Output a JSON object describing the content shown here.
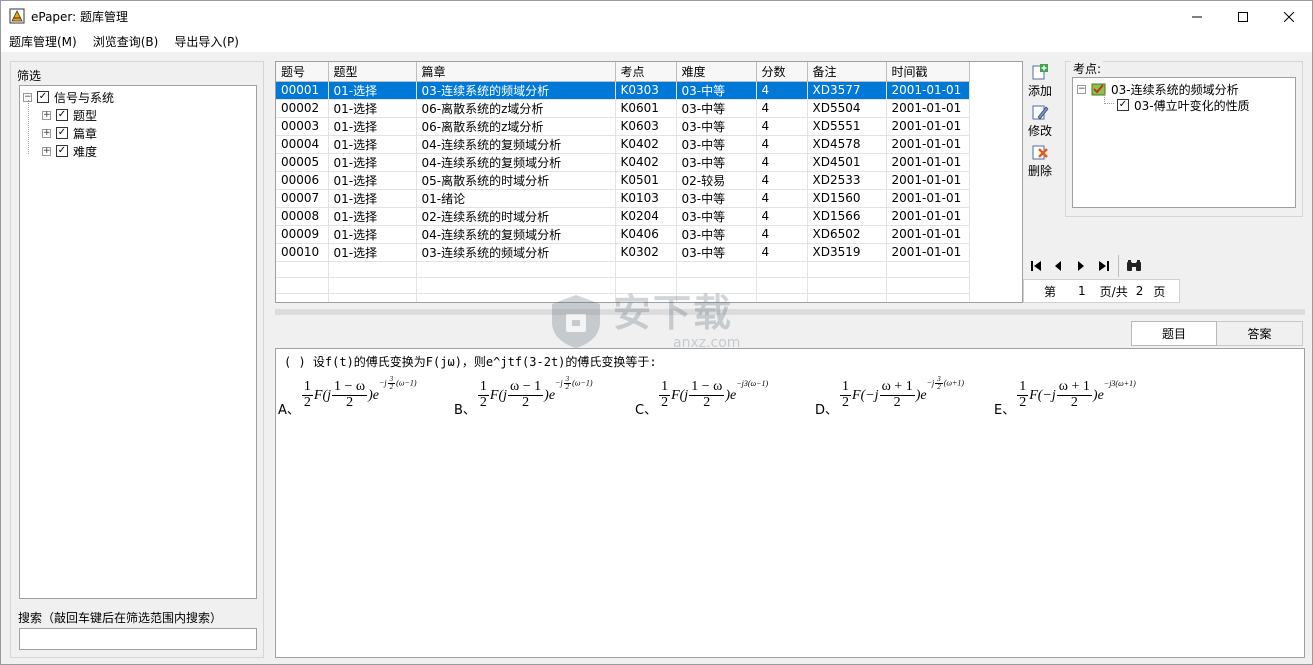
{
  "window": {
    "title": "ePaper: 题库管理",
    "controls": [
      "minimize",
      "maximize",
      "close"
    ]
  },
  "menu": [
    {
      "label": "题库管理(M)"
    },
    {
      "label": "浏览查询(B)"
    },
    {
      "label": "导出导入(P)"
    }
  ],
  "filter": {
    "label": "筛选",
    "tree": {
      "root": {
        "label": "信号与系统",
        "checked": true
      },
      "children": [
        {
          "label": "题型",
          "checked": true
        },
        {
          "label": "篇章",
          "checked": true
        },
        {
          "label": "难度",
          "checked": true
        }
      ]
    },
    "search_label": "搜索（敲回车键后在筛选范围内搜索）",
    "search_value": ""
  },
  "grid": {
    "columns": [
      "题号",
      "题型",
      "篇章",
      "考点",
      "难度",
      "分数",
      "备注",
      "时间戳"
    ],
    "rows": [
      [
        "00001",
        "01-选择",
        "03-连续系统的频域分析",
        "K0303",
        "03-中等",
        "4",
        "XD3577",
        "2001-01-01"
      ],
      [
        "00002",
        "01-选择",
        "06-离散系统的z域分析",
        "K0601",
        "03-中等",
        "4",
        "XD5504",
        "2001-01-01"
      ],
      [
        "00003",
        "01-选择",
        "06-离散系统的z域分析",
        "K0603",
        "03-中等",
        "4",
        "XD5551",
        "2001-01-01"
      ],
      [
        "00004",
        "01-选择",
        "04-连续系统的复频域分析",
        "K0402",
        "03-中等",
        "4",
        "XD4578",
        "2001-01-01"
      ],
      [
        "00005",
        "01-选择",
        "04-连续系统的复频域分析",
        "K0402",
        "03-中等",
        "4",
        "XD4501",
        "2001-01-01"
      ],
      [
        "00006",
        "01-选择",
        "05-离散系统的时域分析",
        "K0501",
        "02-较易",
        "4",
        "XD2533",
        "2001-01-01"
      ],
      [
        "00007",
        "01-选择",
        "01-绪论",
        "K0103",
        "03-中等",
        "4",
        "XD1560",
        "2001-01-01"
      ],
      [
        "00008",
        "01-选择",
        "02-连续系统的时域分析",
        "K0204",
        "03-中等",
        "4",
        "XD1566",
        "2001-01-01"
      ],
      [
        "00009",
        "01-选择",
        "04-连续系统的复频域分析",
        "K0406",
        "03-中等",
        "4",
        "XD6502",
        "2001-01-01"
      ],
      [
        "00010",
        "01-选择",
        "03-连续系统的频域分析",
        "K0302",
        "03-中等",
        "4",
        "XD3519",
        "2001-01-01"
      ]
    ],
    "selected_row": 0
  },
  "tools": {
    "add": "添加",
    "edit": "修改",
    "delete": "删除"
  },
  "kaodian": {
    "label": "考点:",
    "root": "03-连续系统的频域分析",
    "child": "03-傅立叶变化的性质"
  },
  "pager": {
    "prefix": "第",
    "current": "1",
    "middle": "页/共",
    "total": "2",
    "suffix": "页"
  },
  "tabs": {
    "question": "题目",
    "answer": "答案"
  },
  "question": {
    "stem": "(    )  设f(t)的傅氏变换为F(jω)，则e^jtf(3-2t)的傅氏变换等于:",
    "options": [
      "A、",
      "B、",
      "C、",
      "D、",
      "E、"
    ]
  },
  "watermark": {
    "text": "安下载",
    "sub": "anxz.com"
  }
}
